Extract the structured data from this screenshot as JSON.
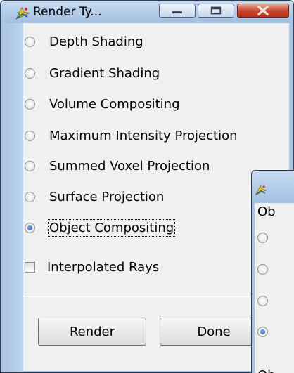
{
  "window": {
    "title": "Render Ty...",
    "icon": "render-app-icon"
  },
  "render_types": [
    {
      "label": "Depth Shading",
      "checked": false
    },
    {
      "label": "Gradient Shading",
      "checked": false
    },
    {
      "label": "Volume Compositing",
      "checked": false
    },
    {
      "label": "Maximum Intensity Projection",
      "checked": false
    },
    {
      "label": "Summed Voxel Projection",
      "checked": false
    },
    {
      "label": "Surface Projection",
      "checked": false
    },
    {
      "label": "Object Compositing",
      "checked": true
    }
  ],
  "interpolated_rays": {
    "label": "Interpolated Rays",
    "checked": false
  },
  "buttons": {
    "render": "Render",
    "done": "Done"
  },
  "second_window": {
    "group_label_top": "Ob",
    "group_label_bottom": "Ob",
    "radios": [
      {
        "checked": false
      },
      {
        "checked": false
      },
      {
        "checked": false
      },
      {
        "checked": true
      }
    ]
  },
  "colors": {
    "titlebar": "#a3c0e1",
    "close_button": "#c8422c",
    "client_bg": "#f0f0f0"
  }
}
